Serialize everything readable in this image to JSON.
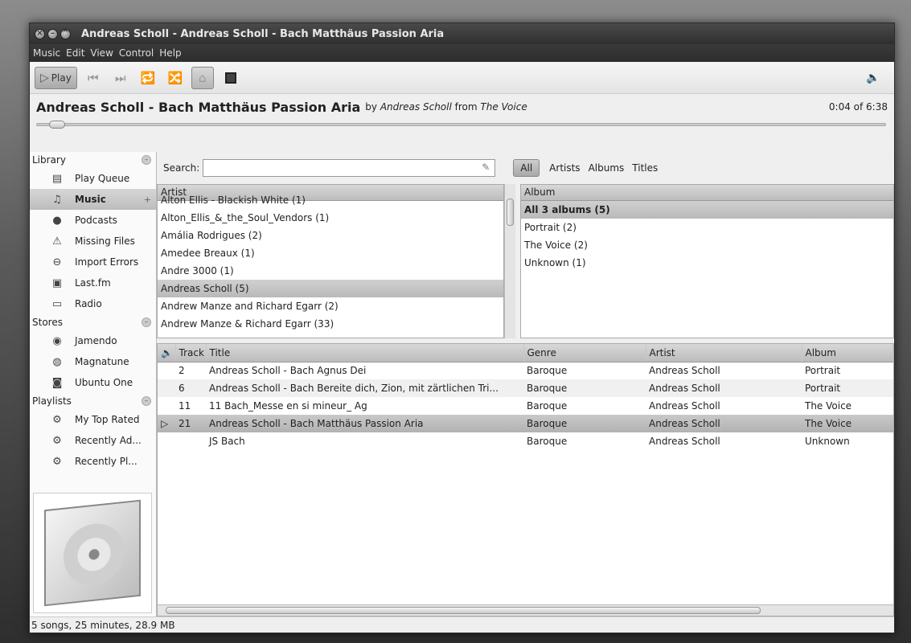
{
  "window": {
    "title": "Andreas Scholl - Andreas Scholl - Bach Matthäus Passion Aria"
  },
  "menu": [
    "Music",
    "Edit",
    "View",
    "Control",
    "Help"
  ],
  "toolbar": {
    "play_label": "Play"
  },
  "now_playing": {
    "song": "Andreas Scholl - Bach Matthäus Passion Aria",
    "by_word": "by",
    "artist": "Andreas Scholl",
    "from_word": "from",
    "album": "The Voice",
    "time": "0:04 of 6:38"
  },
  "sidebar": {
    "library_label": "Library",
    "library_items": [
      {
        "label": "Play Queue",
        "icon": "queue-icon"
      },
      {
        "label": "Music",
        "icon": "music-note-icon"
      },
      {
        "label": "Podcasts",
        "icon": "podcast-icon"
      },
      {
        "label": "Missing Files",
        "icon": "warning-icon"
      },
      {
        "label": "Import Errors",
        "icon": "error-icon"
      },
      {
        "label": "Last.fm",
        "icon": "lastfm-icon"
      },
      {
        "label": "Radio",
        "icon": "radio-icon"
      }
    ],
    "stores_label": "Stores",
    "store_items": [
      {
        "label": "Jamendo",
        "icon": "jamendo-icon"
      },
      {
        "label": "Magnatune",
        "icon": "magnatune-icon"
      },
      {
        "label": "Ubuntu One",
        "icon": "ubuntu-one-icon"
      }
    ],
    "playlists_label": "Playlists",
    "playlist_items": [
      {
        "label": "My Top Rated",
        "icon": "gear-icon"
      },
      {
        "label": "Recently Ad...",
        "icon": "gear-icon"
      },
      {
        "label": "Recently Pl...",
        "icon": "gear-icon"
      }
    ]
  },
  "search": {
    "label": "Search:",
    "value": "",
    "placeholder": ""
  },
  "filters": [
    "All",
    "Artists",
    "Albums",
    "Titles"
  ],
  "artist_pane": {
    "header": "Artist",
    "rows": [
      "Alton Ellis - Blackish White (1)",
      "Alton_Ellis_&_the_Soul_Vendors (1)",
      "Amália Rodrigues (2)",
      "Amedee Breaux (1)",
      "Andre 3000 (1)",
      "Andreas Scholl (5)",
      "Andrew Manze and Richard Egarr (2)",
      "Andrew Manze & Richard Egarr (33)"
    ]
  },
  "album_pane": {
    "header": "Album",
    "rows": [
      "All 3 albums (5)",
      "Portrait (2)",
      "The Voice (2)",
      "Unknown (1)"
    ]
  },
  "tracks": {
    "headers": {
      "track": "Track",
      "title": "Title",
      "genre": "Genre",
      "artist": "Artist",
      "album": "Album"
    },
    "rows": [
      {
        "track": "2",
        "title": "Andreas Scholl - Bach  Agnus Dei",
        "genre": "Baroque",
        "artist": "Andreas Scholl",
        "album": "Portrait"
      },
      {
        "track": "6",
        "title": "Andreas Scholl -  Bach  Bereite dich, Zion, mit zärtlichen Tri...",
        "genre": "Baroque",
        "artist": "Andreas Scholl",
        "album": "Portrait"
      },
      {
        "track": "11",
        "title": "11 Bach_Messe en si mineur_ Ag",
        "genre": "Baroque",
        "artist": "Andreas Scholl",
        "album": "The Voice"
      },
      {
        "track": "21",
        "title": "Andreas Scholl - Bach Matthäus Passion Aria",
        "genre": "Baroque",
        "artist": "Andreas Scholl",
        "album": "The Voice"
      },
      {
        "track": "",
        "title": "JS Bach",
        "genre": "Baroque",
        "artist": "Andreas Scholl",
        "album": "Unknown"
      }
    ]
  },
  "status": "5 songs, 25 minutes, 28.9 MB"
}
